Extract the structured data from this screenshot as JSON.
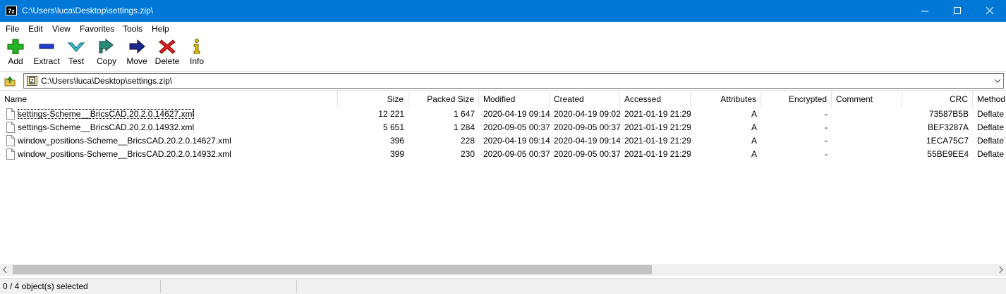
{
  "window": {
    "title": "C:\\Users\\luca\\Desktop\\settings.zip\\",
    "app_icon_text": "7z"
  },
  "menu": [
    "File",
    "Edit",
    "View",
    "Favorites",
    "Tools",
    "Help"
  ],
  "toolbar": {
    "add": "Add",
    "extract": "Extract",
    "test": "Test",
    "copy": "Copy",
    "move": "Move",
    "delete": "Delete",
    "info": "Info"
  },
  "address": {
    "path": "C:\\Users\\luca\\Desktop\\settings.zip\\"
  },
  "columns": [
    "Name",
    "Size",
    "Packed Size",
    "Modified",
    "Created",
    "Accessed",
    "Attributes",
    "Encrypted",
    "Comment",
    "CRC",
    "Method"
  ],
  "files": [
    {
      "name": "settings-Scheme__BricsCAD.20.2.0.14627.xml",
      "size": "12 221",
      "packed": "1 647",
      "modified": "2020-04-19 09:14",
      "created": "2020-04-19 09:02",
      "accessed": "2021-01-19 21:29",
      "attributes": "A",
      "encrypted": "-",
      "comment": "",
      "crc": "73587B5B",
      "method": "Deflate"
    },
    {
      "name": "settings-Scheme__BricsCAD.20.2.0.14932.xml",
      "size": "5 651",
      "packed": "1 284",
      "modified": "2020-09-05 00:37",
      "created": "2020-09-05 00:37",
      "accessed": "2021-01-19 21:29",
      "attributes": "A",
      "encrypted": "-",
      "comment": "",
      "crc": "BEF3287A",
      "method": "Deflate"
    },
    {
      "name": "window_positions-Scheme__BricsCAD.20.2.0.14627.xml",
      "size": "396",
      "packed": "228",
      "modified": "2020-04-19 09:14",
      "created": "2020-04-19 09:14",
      "accessed": "2021-01-19 21:29",
      "attributes": "A",
      "encrypted": "-",
      "comment": "",
      "crc": "1ECA75C7",
      "method": "Deflate"
    },
    {
      "name": "window_positions-Scheme__BricsCAD.20.2.0.14932.xml",
      "size": "399",
      "packed": "230",
      "modified": "2020-09-05 00:37",
      "created": "2020-09-05 00:37",
      "accessed": "2021-01-19 21:29",
      "attributes": "A",
      "encrypted": "-",
      "comment": "",
      "crc": "55BE9EE4",
      "method": "Deflate"
    }
  ],
  "status": {
    "selection": "0 / 4 object(s) selected"
  },
  "colors": {
    "titlebar": "#0078d7",
    "add": "#22b522",
    "extract": "#1f3fcf",
    "test": "#39c9d9",
    "copy": "#2a8a7a",
    "move": "#1a2a8a",
    "delete": "#e02020",
    "info": "#e0c000"
  }
}
